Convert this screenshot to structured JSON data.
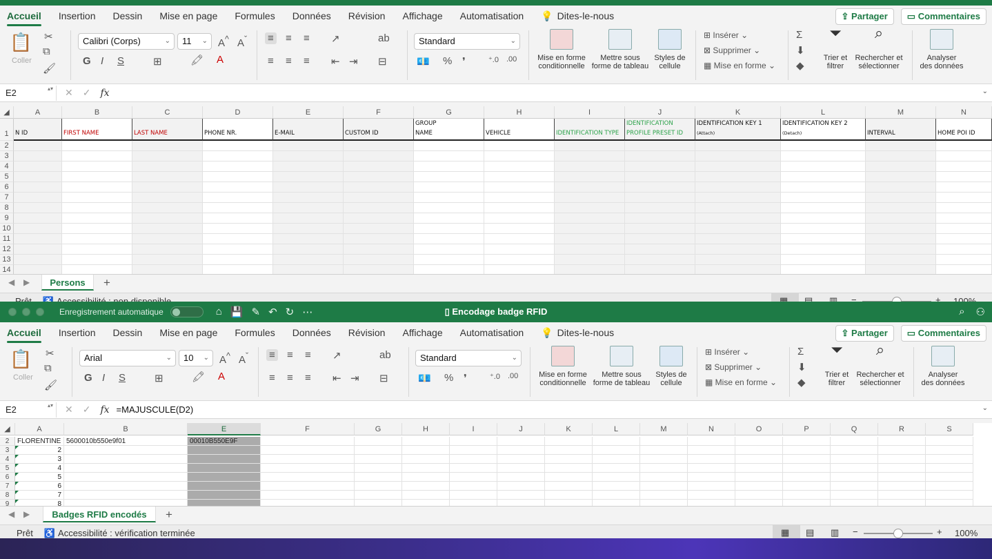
{
  "tabs": [
    "Accueil",
    "Insertion",
    "Dessin",
    "Mise en page",
    "Formules",
    "Données",
    "Révision",
    "Affichage",
    "Automatisation",
    "Dites-le-nous"
  ],
  "share_label": "Partager",
  "comments_label": "Commentaires",
  "ribbon": {
    "paste_label": "Coller",
    "number_format": "Standard",
    "cond_format": [
      "Mise en forme",
      "conditionnelle"
    ],
    "table_format": [
      "Mettre sous",
      "forme de tableau"
    ],
    "cell_styles": [
      "Styles de",
      "cellule"
    ],
    "insert": "Insérer",
    "delete": "Supprimer",
    "format": "Mise en forme",
    "sort": [
      "Trier et",
      "filtrer"
    ],
    "find": [
      "Rechercher et",
      "sélectionner"
    ],
    "analyze": [
      "Analyser",
      "des données"
    ]
  },
  "window1": {
    "font": "Calibri (Corps)",
    "size": "11",
    "namebox": "E2",
    "formula": "",
    "columns": [
      "A",
      "B",
      "C",
      "D",
      "E",
      "F",
      "G",
      "H",
      "I",
      "J",
      "K",
      "L",
      "M",
      "N"
    ],
    "rows": [
      "1",
      "2",
      "3",
      "4",
      "5",
      "6",
      "7",
      "8",
      "9",
      "10",
      "11",
      "12",
      "13",
      "14"
    ],
    "headers": [
      {
        "l1": "",
        "l2": "N ID"
      },
      {
        "l1": "",
        "l2": "FIRST NAME"
      },
      {
        "l1": "",
        "l2": "LAST NAME"
      },
      {
        "l1": "",
        "l2": "PHONE NR."
      },
      {
        "l1": "",
        "l2": "E-MAIL"
      },
      {
        "l1": "",
        "l2": "CUSTOM ID"
      },
      {
        "l1": "GROUP",
        "l2": "NAME"
      },
      {
        "l1": "",
        "l2": "VEHICLE"
      },
      {
        "l1": "",
        "l2": "IDENTIFICATION TYPE"
      },
      {
        "l1": "IDENTIFICATION",
        "l2": "PROFILE PRESET ID"
      },
      {
        "l1": "IDENTIFICATION KEY 1",
        "l2": "(Attach)"
      },
      {
        "l1": "IDENTIFICATION KEY 2",
        "l2": "(Detach)"
      },
      {
        "l1": "",
        "l2": "INTERVAL"
      },
      {
        "l1": "",
        "l2": "HOME POI ID"
      }
    ],
    "sheet": "Persons",
    "status_ready": "Prêt",
    "status_access": "Accessibilité : non disponible",
    "zoom": "100%"
  },
  "window2": {
    "autosave": "Enregistrement automatique",
    "title": "Encodage badge RFID",
    "font": "Arial",
    "size": "10",
    "namebox": "E2",
    "formula": "=MAJUSCULE(D2)",
    "columns": [
      "A",
      "B",
      "E",
      "F",
      "G",
      "H",
      "I",
      "J",
      "K",
      "L",
      "M",
      "N",
      "O",
      "P",
      "Q",
      "R",
      "S"
    ],
    "rows": [
      "2",
      "3",
      "4",
      "5",
      "6",
      "7",
      "8",
      "9"
    ],
    "cellsA": [
      "FLORENTINE",
      "2",
      "3",
      "4",
      "5",
      "6",
      "7",
      "8"
    ],
    "cellB2": "5600010b550e9f01",
    "cellE2": "00010B550E9F",
    "sheet": "Badges RFID encodés",
    "status_ready": "Prêt",
    "status_access": "Accessibilité : vérification terminée",
    "zoom": "100%"
  }
}
